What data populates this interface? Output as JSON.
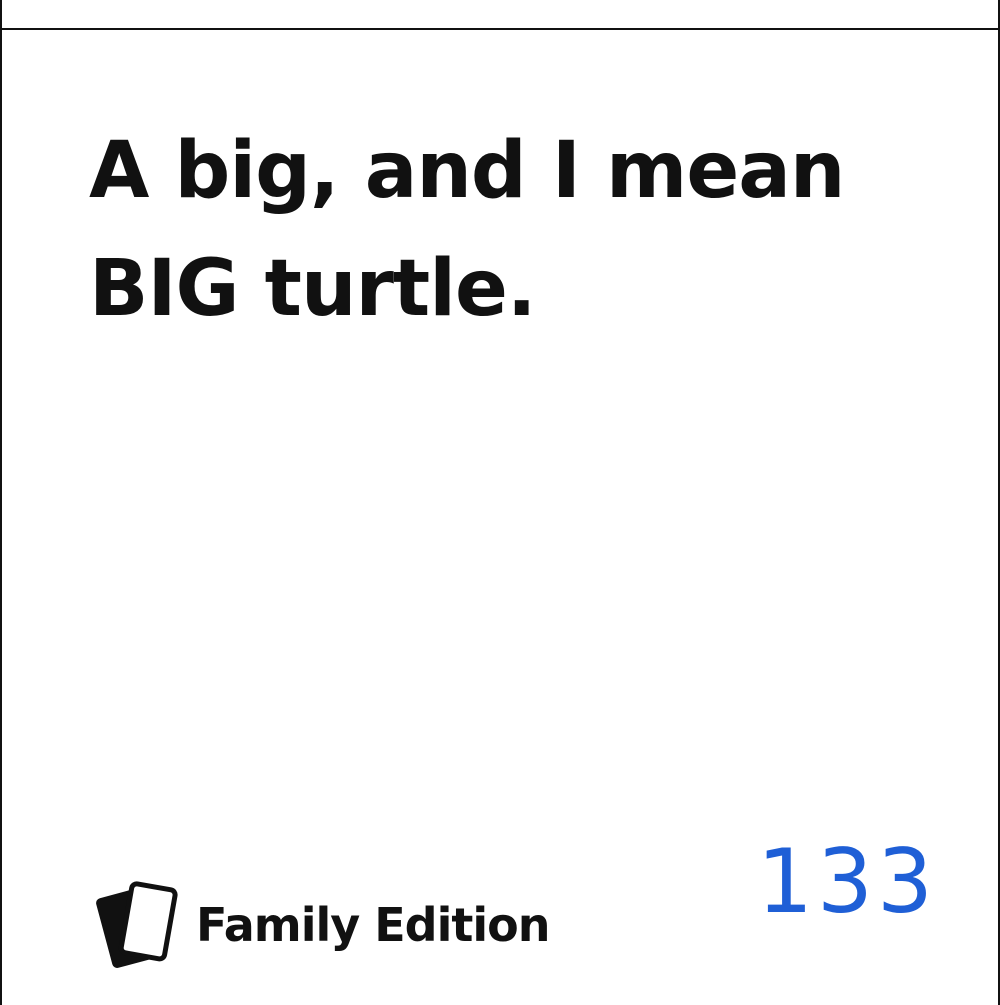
{
  "card": {
    "text": "A big, and I mean BIG turtle.",
    "edition_label": "Family Edition",
    "number": "133",
    "text_color": "#111111",
    "number_color": "#1f5fd6",
    "logo_icon": "stacked-cards-icon"
  }
}
